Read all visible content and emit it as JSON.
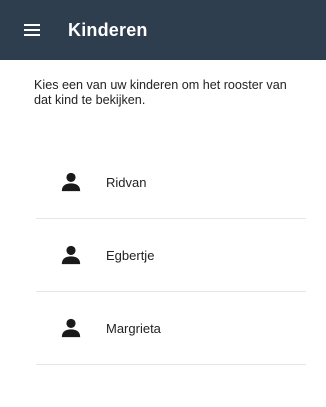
{
  "appbar": {
    "menu_icon": "hamburger-menu-icon",
    "title": "Kinderen",
    "background": "#2f3e4f"
  },
  "intro_text": "Kies een van uw kinderen om het rooster van dat kind te bekijken.",
  "children": [
    {
      "name": "Ridvan",
      "icon": "person-icon"
    },
    {
      "name": "Egbertje",
      "icon": "person-icon"
    },
    {
      "name": "Margrieta",
      "icon": "person-icon"
    }
  ]
}
